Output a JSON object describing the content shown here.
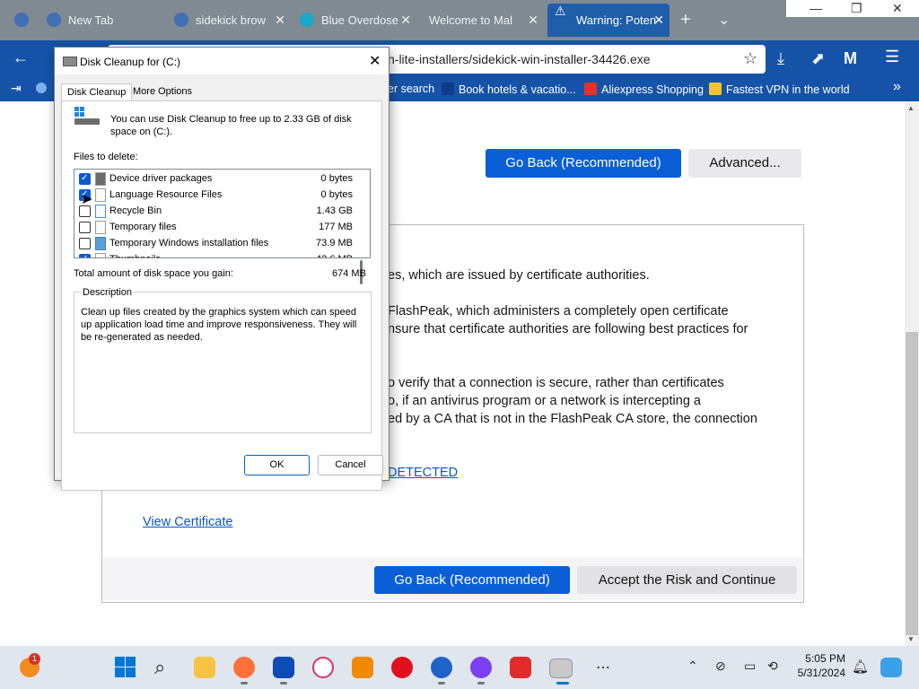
{
  "browser": {
    "tabs": [
      {
        "label": "New Tab"
      },
      {
        "label": "sidekick brow"
      },
      {
        "label": "Blue Overdose"
      },
      {
        "label": "Welcome to Mal"
      },
      {
        "label": "Warning: Poten"
      }
    ],
    "url": "n-lite-installers/sidekick-win-installer-34426.exe",
    "bookmarks": [
      {
        "label": "er search"
      },
      {
        "label": "Book hotels & vacatio..."
      },
      {
        "label": "Aliexpress Shopping"
      },
      {
        "label": "Fastest VPN in the world"
      }
    ]
  },
  "page": {
    "go_back_label": "Go Back (Recommended)",
    "advanced_label": "Advanced...",
    "paragraph_lines": [
      "es, which are issued by certificate authorities.",
      "FlashPeak, which administers a completely open certificate",
      "nsure that certificate authorities are following best practices for",
      "o verify that a connection is secure, rather than certificates",
      "o, if an antivirus program or a network is intercepting a",
      "ed by a CA that is not in the FlashPeak CA store, the connection"
    ],
    "error_code_link": "DETECTED",
    "view_certificate_link": "View Certificate",
    "go_back_bottom_label": "Go Back (Recommended)",
    "accept_risk_label": "Accept the Risk and Continue"
  },
  "dialog": {
    "title": "Disk Cleanup for  (C:)",
    "tabs": [
      "Disk Cleanup",
      "More Options"
    ],
    "intro": "You can use Disk Cleanup to free up to 2.33 GB of disk space on  (C:).",
    "files_label": "Files to delete:",
    "files": [
      {
        "name": "Device driver packages",
        "size": "0 bytes",
        "checked": true
      },
      {
        "name": "Language Resource Files",
        "size": "0 bytes",
        "checked": true
      },
      {
        "name": "Recycle Bin",
        "size": "1.43 GB",
        "checked": false
      },
      {
        "name": "Temporary files",
        "size": "177 MB",
        "checked": false
      },
      {
        "name": "Temporary Windows installation files",
        "size": "73.9 MB",
        "checked": false
      },
      {
        "name": "Thumbnails",
        "size": "42.6 MB",
        "checked": true
      }
    ],
    "total_label": "Total amount of disk space you gain:",
    "total_value": "674 MB",
    "description_label": "Description",
    "description_text": "Clean up files created by the graphics system which can speed up application load time and improve responsiveness. They will be re-generated as needed.",
    "ok_label": "OK",
    "cancel_label": "Cancel"
  },
  "taskbar": {
    "notification_badge": "1",
    "time": "5:05 PM",
    "date": "5/31/2024"
  },
  "colors": {
    "browser_accent": "#1553a8",
    "button_blue": "#0a5fd6",
    "checkbox_blue": "#0b5bcf"
  }
}
